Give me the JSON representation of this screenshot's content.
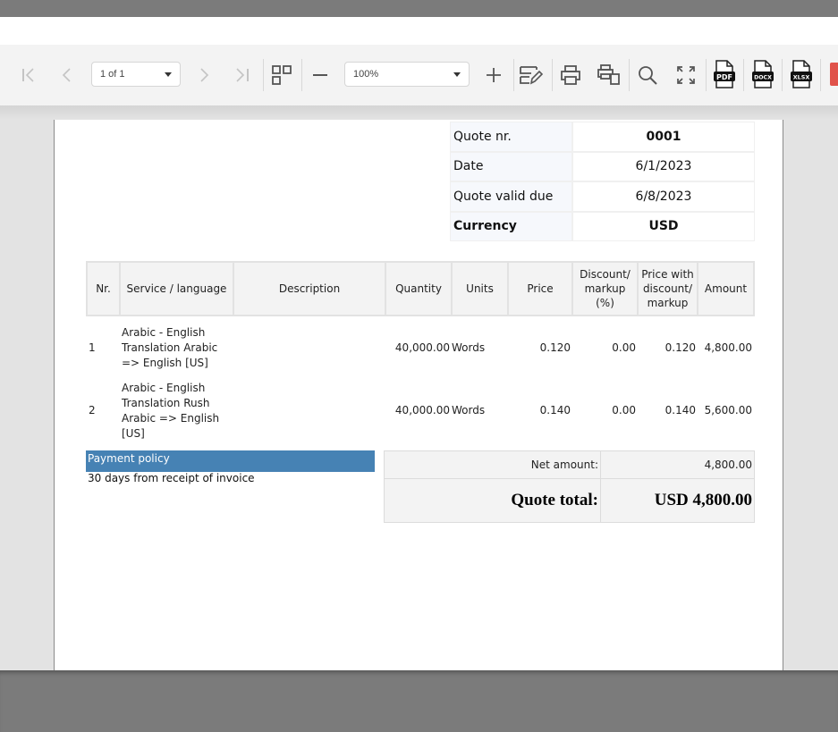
{
  "toolbar": {
    "page_selector": {
      "value": "1 of 1"
    },
    "zoom_selector": {
      "value": "100%"
    },
    "buttons": {
      "first_page": "first-page-icon",
      "prev_page": "previous-page-icon",
      "next_page": "next-page-icon",
      "last_page": "last-page-icon",
      "thumbnails": "thumbnails-icon",
      "zoom_out": "zoom-out-icon",
      "zoom_in": "zoom-in-icon",
      "edit": "edit-icon",
      "print": "print-icon",
      "print_page": "print-page-icon",
      "search": "search-icon",
      "fullscreen": "fullscreen-icon"
    },
    "exports": [
      "PDF",
      "DOCX",
      "XLSX"
    ],
    "colors": {
      "accent_red": "#e0524a"
    }
  },
  "document": {
    "meta": [
      {
        "label": "Quote nr.",
        "value": "0001",
        "bold_label": false,
        "bold_value": true
      },
      {
        "label": "Date",
        "value": "6/1/2023",
        "bold_label": false,
        "bold_value": false
      },
      {
        "label": "Quote valid due",
        "value": "6/8/2023",
        "bold_label": false,
        "bold_value": false
      },
      {
        "label": "Currency",
        "value": "USD",
        "bold_label": true,
        "bold_value": true
      }
    ],
    "items_table": {
      "headers": [
        "Nr.",
        "Service / language",
        "Description",
        "Quantity",
        "Units",
        "Price",
        "Discount/ markup (%)",
        "Price with discount/ markup",
        "Amount"
      ],
      "rows": [
        {
          "nr": "1",
          "service": "Arabic - English Translation Arabic => English [US]",
          "description": "",
          "quantity": "40,000.00",
          "units": "Words",
          "price": "0.120",
          "discount": "0.00",
          "price_with_discount": "0.120",
          "amount": "4,800.00"
        },
        {
          "nr": "2",
          "service": "Arabic - English Translation Rush Arabic => English [US]",
          "description": "",
          "quantity": "40,000.00",
          "units": "Words",
          "price": "0.140",
          "discount": "0.00",
          "price_with_discount": "0.140",
          "amount": "5,600.00"
        }
      ]
    },
    "payment_policy": {
      "heading": "Payment policy",
      "text": "30 days from receipt of invoice",
      "heading_color": "#4682b4"
    },
    "totals": {
      "net_amount_label": "Net amount:",
      "net_amount_value": "4,800.00",
      "quote_total_label": "Quote total:",
      "quote_total_value": "USD 4,800.00"
    }
  }
}
